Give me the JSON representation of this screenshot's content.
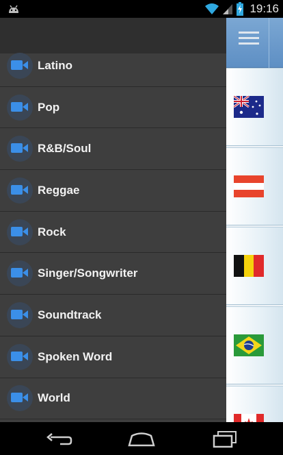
{
  "status_bar": {
    "time": "19:16",
    "icons": [
      "android-icon",
      "wifi-icon",
      "signal-icon",
      "battery-charging-icon"
    ]
  },
  "drawer": {
    "items": [
      {
        "label": "Latino",
        "icon": "video-camera-icon"
      },
      {
        "label": "Pop",
        "icon": "video-camera-icon"
      },
      {
        "label": "R&B/Soul",
        "icon": "video-camera-icon"
      },
      {
        "label": "Reggae",
        "icon": "video-camera-icon"
      },
      {
        "label": "Rock",
        "icon": "video-camera-icon"
      },
      {
        "label": "Singer/Songwriter",
        "icon": "video-camera-icon"
      },
      {
        "label": "Soundtrack",
        "icon": "video-camera-icon"
      },
      {
        "label": "Spoken Word",
        "icon": "video-camera-icon"
      },
      {
        "label": "World",
        "icon": "video-camera-icon"
      }
    ]
  },
  "content": {
    "menu_icon": "hamburger-menu-icon",
    "flags": [
      "flag-australia-icon",
      "flag-austria-icon",
      "flag-belgium-icon",
      "flag-brazil-icon",
      "flag-canada-icon"
    ]
  },
  "nav_bar": {
    "buttons": [
      "back-icon",
      "home-icon",
      "recent-apps-icon"
    ]
  },
  "colors": {
    "drawer_bg": "#3e3e3e",
    "accent_icon": "#3b8fe8",
    "header_blue": "#6b9bcd"
  }
}
